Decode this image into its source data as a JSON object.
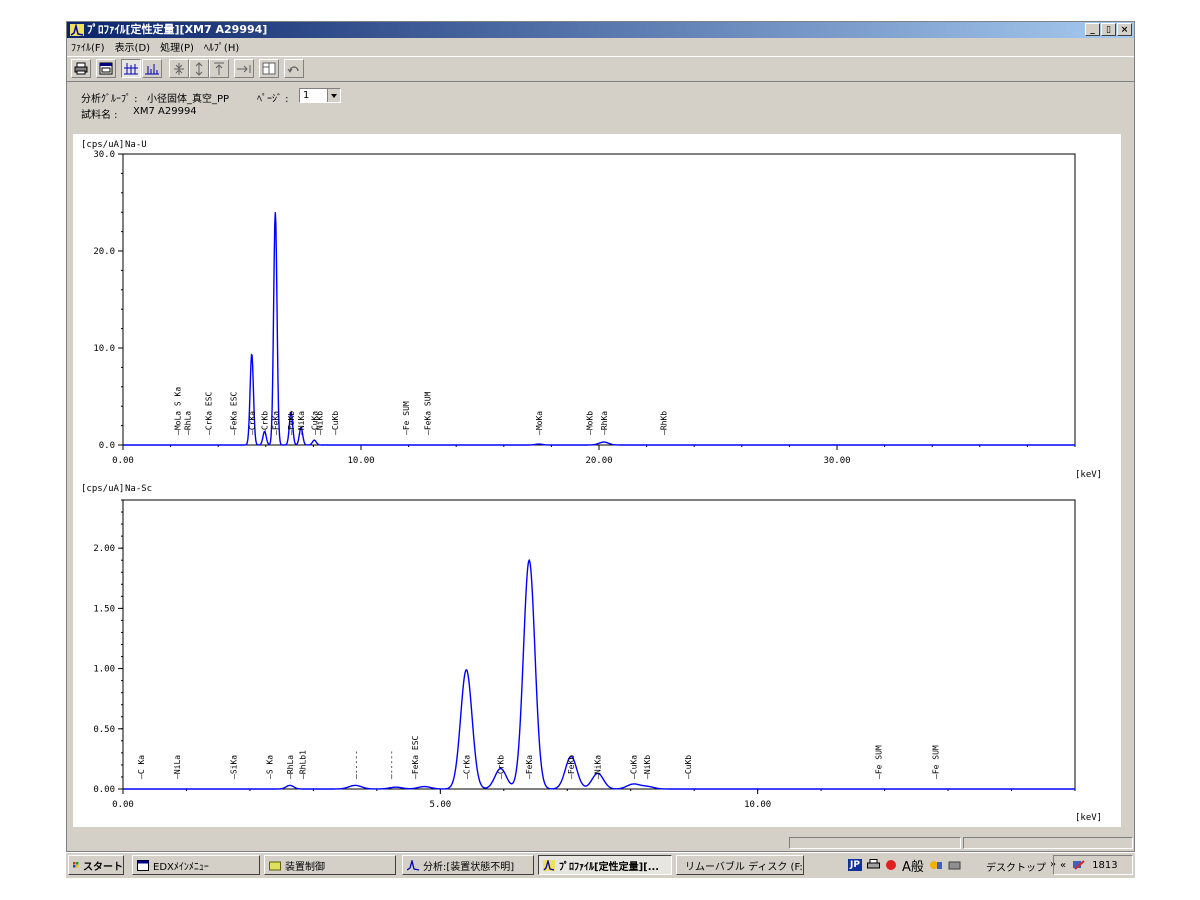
{
  "window": {
    "title": "ﾌﾟﾛﾌｧｲﾙ[定性定量][XM7 A29994]",
    "min": "_",
    "max": "▯",
    "close": "×"
  },
  "menu": [
    "ﾌｧｲﾙ(F)",
    "表示(D)",
    "処理(P)",
    "ﾍﾙﾌﾟ(H)"
  ],
  "info": {
    "group_label": "分析ｸﾞﾙｰﾌﾟ :",
    "group_value": "小径固体_真空_PP",
    "page_label": "ﾍﾟｰｼﾞ :",
    "page_value": "1",
    "sample_label": "試料名 :",
    "sample_value": "XM7 A29994"
  },
  "chart_data": [
    {
      "type": "line",
      "ylabel": "[cps/uA]",
      "title": "Na-U",
      "xlabel": "[keV]",
      "xlim": [
        0,
        40
      ],
      "ylim": [
        0,
        30
      ],
      "yticks": [
        "0.0",
        "10.0",
        "20.0",
        "30.0"
      ],
      "xticks": [
        "0.00",
        "10.00",
        "20.00",
        "30.00"
      ],
      "color": "#0000ff",
      "peaks": [
        {
          "x": 5.41,
          "h": 9.4,
          "w": 0.07
        },
        {
          "x": 5.95,
          "h": 1.4,
          "w": 0.07
        },
        {
          "x": 6.4,
          "h": 24.0,
          "w": 0.07
        },
        {
          "x": 7.06,
          "h": 3.4,
          "w": 0.07
        },
        {
          "x": 7.48,
          "h": 1.8,
          "w": 0.07
        },
        {
          "x": 8.04,
          "h": 0.5,
          "w": 0.08
        },
        {
          "x": 17.48,
          "h": 0.1,
          "w": 0.15
        },
        {
          "x": 20.2,
          "h": 0.3,
          "w": 0.2
        }
      ],
      "annotations": [
        {
          "x": 2.29,
          "label": "MoLa S Ka"
        },
        {
          "x": 2.7,
          "label": "RhLa"
        },
        {
          "x": 3.6,
          "label": "CrKa ESC"
        },
        {
          "x": 4.65,
          "label": "FeKa ESC"
        },
        {
          "x": 5.41,
          "label": "CrKa"
        },
        {
          "x": 5.95,
          "label": "CrKb"
        },
        {
          "x": 6.4,
          "label": "FeKa"
        },
        {
          "x": 7.06,
          "label": "FeKb"
        },
        {
          "x": 7.48,
          "label": "NiKa"
        },
        {
          "x": 8.04,
          "label": "CuKa"
        },
        {
          "x": 8.26,
          "label": "NiKb"
        },
        {
          "x": 8.9,
          "label": "CuKb"
        },
        {
          "x": 11.9,
          "label": "Fe  SUM"
        },
        {
          "x": 12.8,
          "label": "FeKa SUM"
        },
        {
          "x": 17.48,
          "label": "MoKa"
        },
        {
          "x": 19.6,
          "label": "MoKb"
        },
        {
          "x": 20.2,
          "label": "RhKa"
        },
        {
          "x": 22.7,
          "label": "RhKb"
        }
      ]
    },
    {
      "type": "line",
      "ylabel": "[cps/uA]",
      "title": "Na-Sc",
      "xlabel": "[keV]",
      "xlim": [
        0,
        15
      ],
      "ylim": [
        0,
        2.4
      ],
      "yticks": [
        "0.00",
        "0.50",
        "1.00",
        "1.50",
        "2.00"
      ],
      "xticks": [
        "0.00",
        "5.00",
        "10.00"
      ],
      "color": "#0000ff",
      "peaks": [
        {
          "x": 2.63,
          "h": 0.03,
          "w": 0.06
        },
        {
          "x": 3.66,
          "h": 0.03,
          "w": 0.1
        },
        {
          "x": 4.3,
          "h": 0.015,
          "w": 0.1
        },
        {
          "x": 4.75,
          "h": 0.02,
          "w": 0.1
        },
        {
          "x": 5.41,
          "h": 0.99,
          "w": 0.09
        },
        {
          "x": 5.95,
          "h": 0.17,
          "w": 0.09
        },
        {
          "x": 6.4,
          "h": 1.9,
          "w": 0.09
        },
        {
          "x": 7.06,
          "h": 0.27,
          "w": 0.09
        },
        {
          "x": 7.48,
          "h": 0.13,
          "w": 0.09
        },
        {
          "x": 8.04,
          "h": 0.04,
          "w": 0.1
        },
        {
          "x": 8.26,
          "h": 0.02,
          "w": 0.1
        }
      ],
      "annotations": [
        {
          "x": 0.28,
          "label": "C Ka"
        },
        {
          "x": 0.85,
          "label": "NiLa"
        },
        {
          "x": 1.74,
          "label": "SiKa"
        },
        {
          "x": 2.31,
          "label": "S Ka"
        },
        {
          "x": 2.63,
          "label": "RhLa"
        },
        {
          "x": 2.83,
          "label": "RhLb1"
        },
        {
          "x": 3.66,
          "label": "-----"
        },
        {
          "x": 4.22,
          "label": "-----"
        },
        {
          "x": 4.6,
          "label": "FeKa ESC"
        },
        {
          "x": 5.41,
          "label": "CrKa"
        },
        {
          "x": 5.95,
          "label": "CrKb"
        },
        {
          "x": 6.4,
          "label": "FeKa"
        },
        {
          "x": 7.06,
          "label": "FeKb"
        },
        {
          "x": 7.48,
          "label": "NiKa"
        },
        {
          "x": 8.04,
          "label": "CuKa"
        },
        {
          "x": 8.26,
          "label": "NiKb"
        },
        {
          "x": 8.9,
          "label": "CuKb"
        },
        {
          "x": 11.9,
          "label": "Fe  SUM"
        },
        {
          "x": 12.8,
          "label": "Fe  SUM"
        }
      ]
    }
  ],
  "taskbar": {
    "start": "スタート",
    "items": [
      "EDXﾒｲﾝﾒﾆｭｰ",
      "装置制御",
      "分析:[装置状態不明]",
      "ﾌﾟﾛﾌｧｲﾙ[定性定量][...",
      "リムーバブル ディスク (F:)"
    ],
    "ime": "JP",
    "ime2": "A般",
    "desktop": "デスクトップ",
    "chevron": "»",
    "back": "«",
    "clock": "1813"
  }
}
